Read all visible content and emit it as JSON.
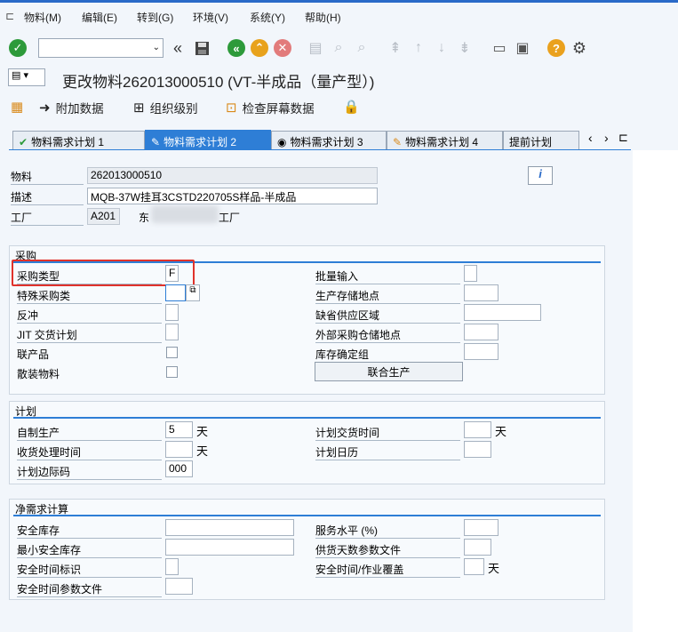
{
  "menubar": {
    "items": [
      "物料(M)",
      "编辑(E)",
      "转到(G)",
      "环境(V)",
      "系统(Y)",
      "帮助(H)"
    ]
  },
  "toolbar": {
    "command_value": "",
    "icons": [
      "enter-icon",
      "back-double-icon",
      "save-icon",
      "back-icon",
      "exit-icon",
      "cancel-icon",
      "print-icon",
      "find-icon",
      "find-next-icon",
      "first-page-icon",
      "prev-page-icon",
      "next-page-icon",
      "last-page-icon",
      "new-session-icon",
      "shortcut-icon",
      "help-icon",
      "settings-icon"
    ]
  },
  "title": "更改物料262013000510 (VT-半成品（量产型）)",
  "app_toolbar": {
    "additional_data": "附加数据",
    "org_levels": "组织级别",
    "check_screen": "检查屏幕数据"
  },
  "tabs": [
    {
      "label": "物料需求计划 1",
      "active": false
    },
    {
      "label": "物料需求计划 2",
      "active": true
    },
    {
      "label": "物料需求计划 3",
      "active": false
    },
    {
      "label": "物料需求计划 4",
      "active": false
    },
    {
      "label": "提前计划",
      "active": false
    }
  ],
  "header": {
    "material_label": "物料",
    "material_value": "262013000510",
    "desc_label": "描述",
    "desc_value": "MQB-37W挂耳3CSTD220705S样品-半成品",
    "plant_label": "工厂",
    "plant_value": "A201",
    "plant_name_prefix": "东",
    "plant_name_suffix": "工厂"
  },
  "procurement": {
    "title": "采购",
    "proc_type_label": "采购类型",
    "proc_type_value": "F",
    "special_proc_label": "特殊采购类",
    "backflush_label": "反冲",
    "jit_label": "JIT 交货计划",
    "coproduct_label": "联产品",
    "bulk_label": "散装物料",
    "batch_entry_label": "批量输入",
    "prod_storage_label": "生产存储地点",
    "default_supply_label": "缺省供应区域",
    "ext_storage_label": "外部采购仓储地点",
    "stock_det_label": "库存确定组",
    "joint_prod_button": "联合生产"
  },
  "planning": {
    "title": "计划",
    "inhouse_label": "自制生产",
    "inhouse_value": "5",
    "inhouse_unit": "天",
    "gr_label": "收货处理时间",
    "gr_unit": "天",
    "margin_label": "计划边际码",
    "margin_value": "000",
    "planned_delivery_label": "计划交货时间",
    "planned_delivery_unit": "天",
    "calendar_label": "计划日历"
  },
  "net_req": {
    "title": "净需求计算",
    "safety_stock_label": "安全库存",
    "min_safety_label": "最小安全库存",
    "safety_time_ind_label": "安全时间标识",
    "safety_time_profile_label": "安全时间参数文件",
    "service_level_label": "服务水平 (%)",
    "coverage_profile_label": "供货天数参数文件",
    "safety_time_label": "安全时间/作业覆盖",
    "safety_time_unit": "天"
  },
  "colors": {
    "accent": "#2e7ed6",
    "highlight": "#e0322b"
  }
}
